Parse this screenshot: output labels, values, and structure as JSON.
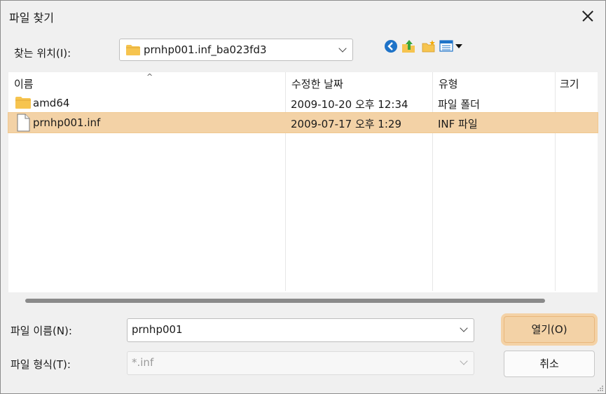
{
  "dialog": {
    "title": "파일 찾기",
    "lookin_label": "찾는 위치(I):",
    "lookin_value": "prnhp001.inf_ba023fd3"
  },
  "toolbar": {
    "back_icon": "back-arrow-icon",
    "up_icon": "up-folder-icon",
    "new_folder_icon": "new-folder-icon",
    "view_icon": "view-menu-icon"
  },
  "columns": {
    "name": "이름",
    "modified": "수정한 날짜",
    "type": "유형",
    "size": "크기"
  },
  "files": [
    {
      "name": "amd64",
      "modified": "2009-10-20 오후 12:34",
      "type": "파일 폴더",
      "kind": "folder"
    },
    {
      "name": "prnhp001.inf",
      "modified": "2009-07-17 오후 1:29",
      "type": "INF 파일",
      "kind": "file"
    }
  ],
  "filename": {
    "label": "파일 이름(N):",
    "value": "prnhp001"
  },
  "filetype": {
    "label": "파일 형식(T):",
    "value": "*.inf"
  },
  "buttons": {
    "open": "열기(O)",
    "cancel": "취소"
  },
  "colors": {
    "selection": "#f3d2a6",
    "folder": "#f6c44f"
  }
}
